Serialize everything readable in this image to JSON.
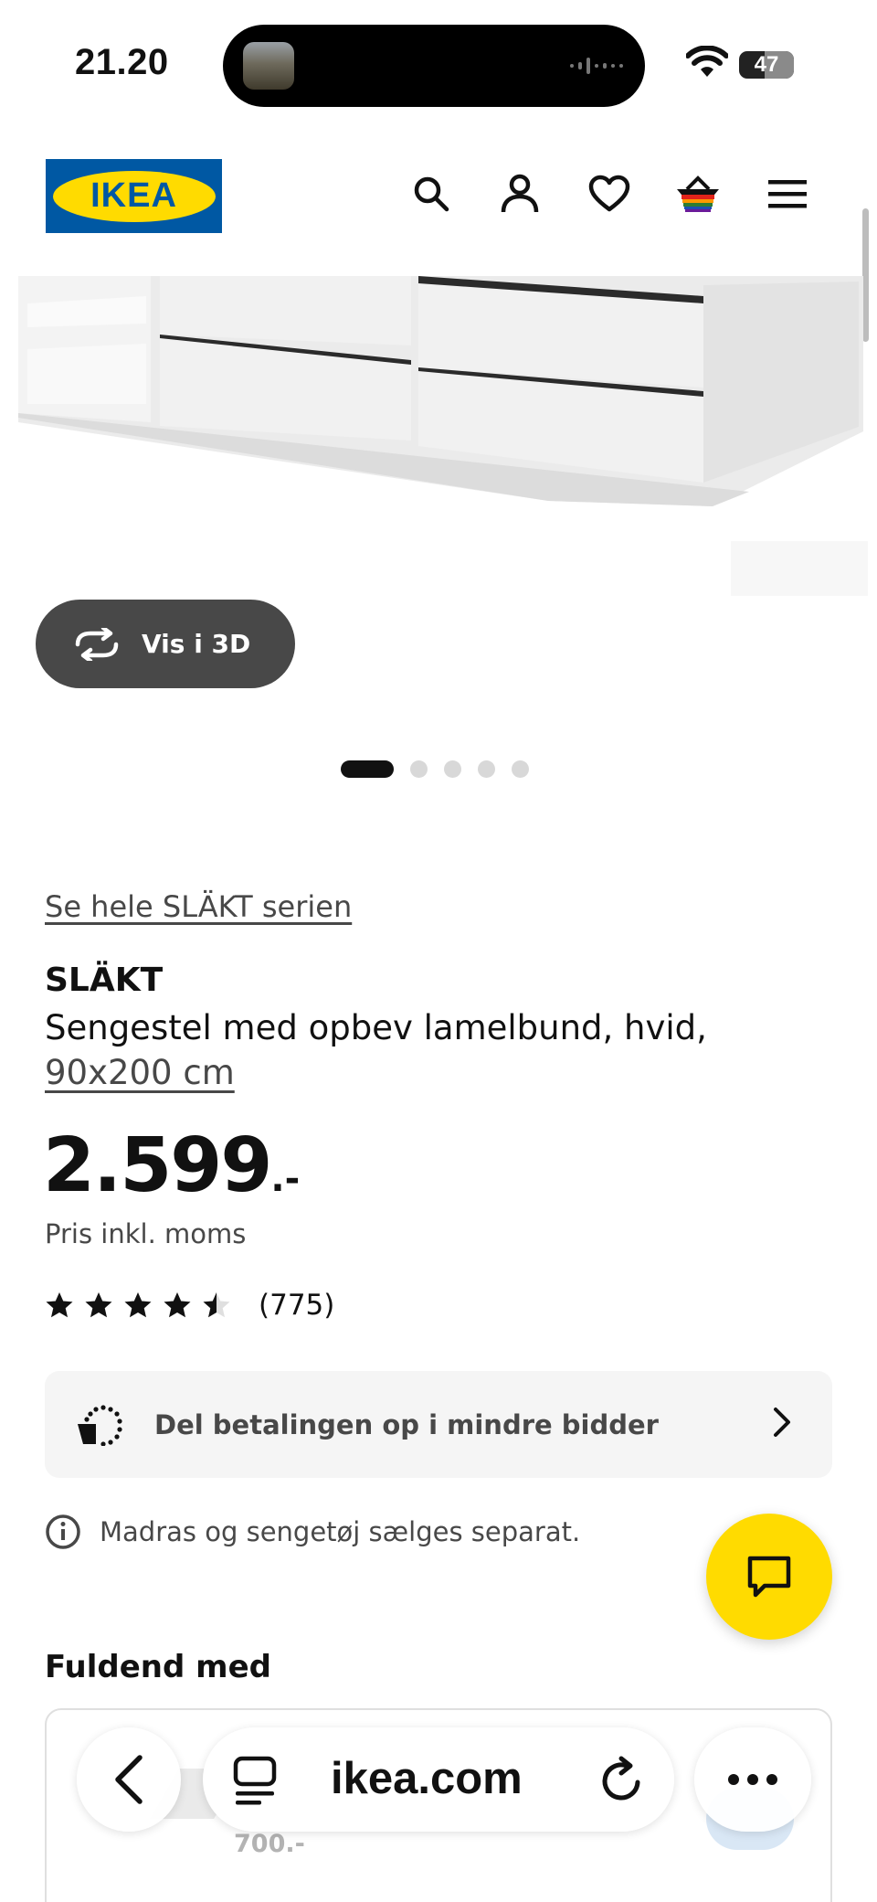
{
  "status_bar": {
    "time": "21.20",
    "battery": "47",
    "battery_fraction": 0.47
  },
  "header": {
    "logo_text": "IKEA",
    "brand_colors": {
      "blue": "#0058a3",
      "yellow": "#ffdb00"
    },
    "icons": [
      "search-icon",
      "account-icon",
      "wishlist-heart-icon",
      "cart-basket-icon",
      "menu-hamburger-icon"
    ]
  },
  "gallery": {
    "view_3d_label": "Vis i 3D",
    "image_count": 5,
    "active_index": 0
  },
  "product": {
    "series_link": "Se hele SLÄKT serien",
    "name": "SLÄKT",
    "description": "Sengestel med opbev lamelbund, hvid,",
    "size": "90x200 cm",
    "price": "2.599",
    "price_suffix": ".-",
    "price_note": "Pris inkl. moms",
    "rating": 4.5,
    "rating_max": 5,
    "review_count": "(775)"
  },
  "payment": {
    "label": "Del betalingen op i mindre bidder"
  },
  "info": {
    "text": "Madras og sengetøj sælges separat."
  },
  "complete": {
    "heading": "Fuldend med",
    "item_price": "700.-"
  },
  "browser": {
    "url": "ikea.com"
  }
}
